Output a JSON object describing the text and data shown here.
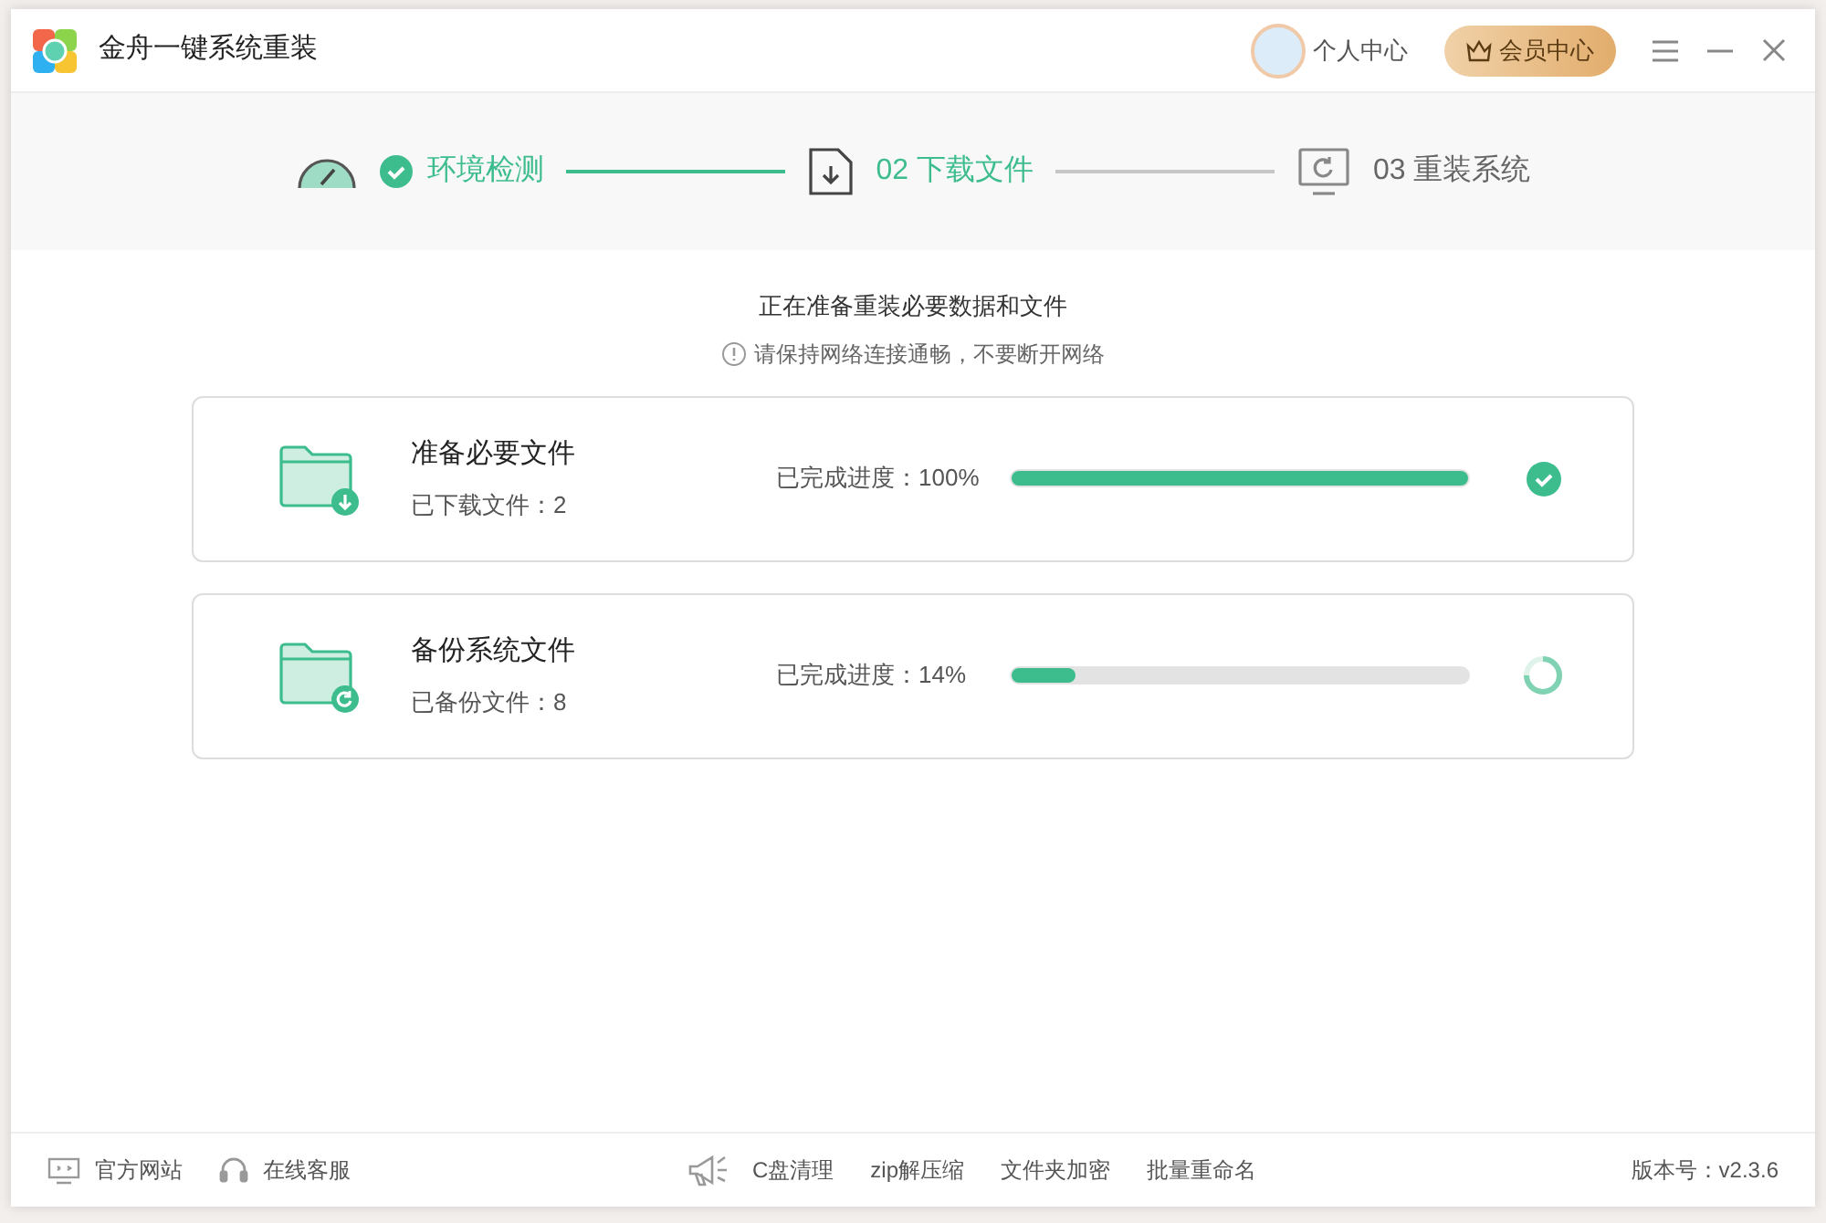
{
  "window": {
    "title": "金舟一键系统重装"
  },
  "header": {
    "profile": "个人中心",
    "vip_button": "会员中心"
  },
  "steps": [
    {
      "label": "环境检测",
      "done": true,
      "reached": true
    },
    {
      "label": "02 下载文件",
      "done": false,
      "reached": true
    },
    {
      "label": "03 重装系统",
      "done": false,
      "reached": false
    }
  ],
  "heading": "正在准备重装必要数据和文件",
  "notice": "请保持网络连接通畅，不要断开网络",
  "tasks": [
    {
      "title": "准备必要文件",
      "detail": "已下载文件：2",
      "progress_label": "已完成进度：100%",
      "level": 1,
      "done": true
    },
    {
      "title": "备份系统文件",
      "detail": "已备份文件：8",
      "progress_label": "已完成进度：14%",
      "level": 0.14,
      "done": false
    }
  ],
  "footer": {
    "links": [
      "官方网站",
      "在线客服"
    ],
    "tools": [
      "C盘清理",
      "zip解压缩",
      "文件夹加密",
      "批量重命名"
    ],
    "version": "版本号：v2.3.6"
  }
}
